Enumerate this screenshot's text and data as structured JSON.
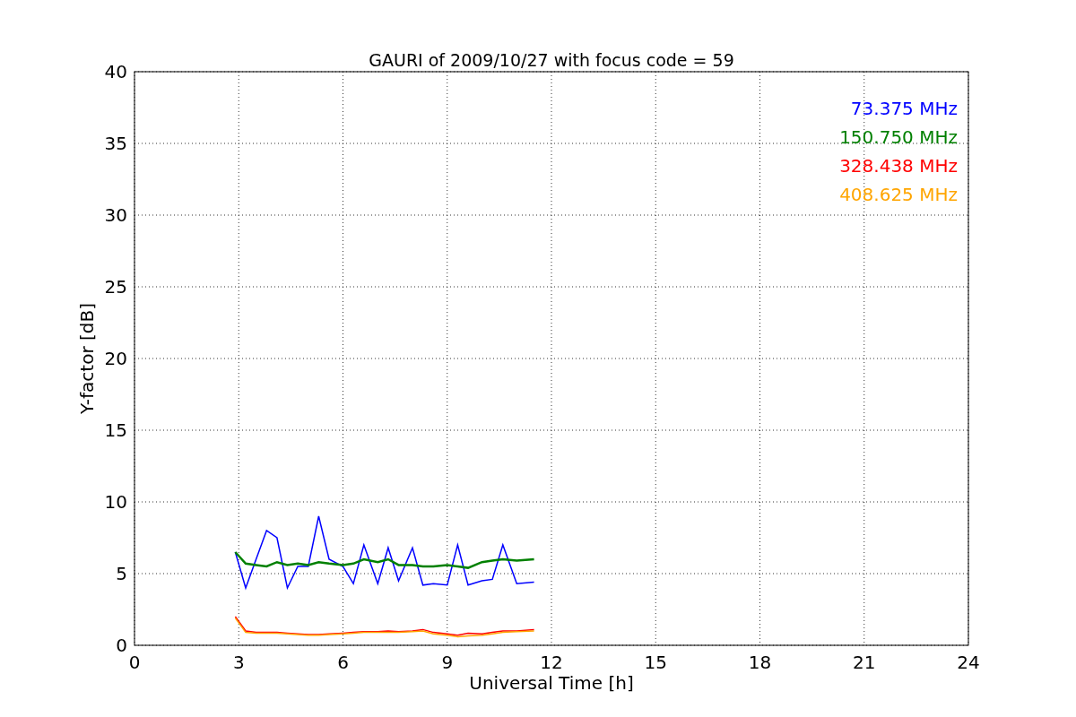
{
  "chart_data": {
    "type": "line",
    "title": "GAURI of 2009/10/27 with focus code = 59",
    "xlabel": "Universal Time [h]",
    "ylabel": "Y-factor [dB]",
    "x": [
      2.9,
      3.2,
      3.5,
      3.8,
      4.1,
      4.4,
      4.7,
      5.0,
      5.3,
      5.6,
      6.0,
      6.3,
      6.6,
      7.0,
      7.3,
      7.6,
      8.0,
      8.3,
      8.6,
      9.0,
      9.3,
      9.6,
      10.0,
      10.3,
      10.6,
      11.0,
      11.5
    ],
    "series": [
      {
        "name": "73.375 MHz",
        "color": "#0000ff",
        "values": [
          6.5,
          4.0,
          6.0,
          8.0,
          7.5,
          4.0,
          5.5,
          5.5,
          9.0,
          6.0,
          5.5,
          4.3,
          7.0,
          4.3,
          6.8,
          4.5,
          6.8,
          4.2,
          4.3,
          4.2,
          7.0,
          4.2,
          4.5,
          4.6,
          7.0,
          4.3,
          4.4
        ]
      },
      {
        "name": "150.750 MHz",
        "color": "#008000",
        "values": [
          6.5,
          5.7,
          5.6,
          5.5,
          5.8,
          5.6,
          5.7,
          5.6,
          5.8,
          5.7,
          5.6,
          5.7,
          6.0,
          5.8,
          6.0,
          5.6,
          5.6,
          5.5,
          5.5,
          5.6,
          5.5,
          5.4,
          5.8,
          5.9,
          6.0,
          5.9,
          6.0
        ]
      },
      {
        "name": "328.438 MHz",
        "color": "#ff0000",
        "values": [
          2.0,
          1.0,
          0.9,
          0.9,
          0.9,
          0.85,
          0.8,
          0.75,
          0.75,
          0.8,
          0.85,
          0.9,
          0.95,
          0.95,
          1.0,
          0.95,
          1.0,
          1.1,
          0.9,
          0.8,
          0.7,
          0.85,
          0.8,
          0.9,
          1.0,
          1.0,
          1.1
        ]
      },
      {
        "name": "408.625 MHz",
        "color": "#ffa500",
        "values": [
          1.9,
          0.9,
          0.85,
          0.85,
          0.85,
          0.8,
          0.75,
          0.7,
          0.7,
          0.75,
          0.8,
          0.85,
          0.9,
          0.9,
          0.9,
          0.9,
          0.95,
          1.0,
          0.8,
          0.7,
          0.6,
          0.65,
          0.7,
          0.8,
          0.9,
          0.95,
          1.0
        ]
      }
    ],
    "xlim": [
      0,
      24
    ],
    "ylim": [
      0,
      40
    ],
    "xticks": [
      0,
      3,
      6,
      9,
      12,
      15,
      18,
      21,
      24
    ],
    "yticks": [
      0,
      5,
      10,
      15,
      20,
      25,
      30,
      35,
      40
    ],
    "grid": true
  }
}
